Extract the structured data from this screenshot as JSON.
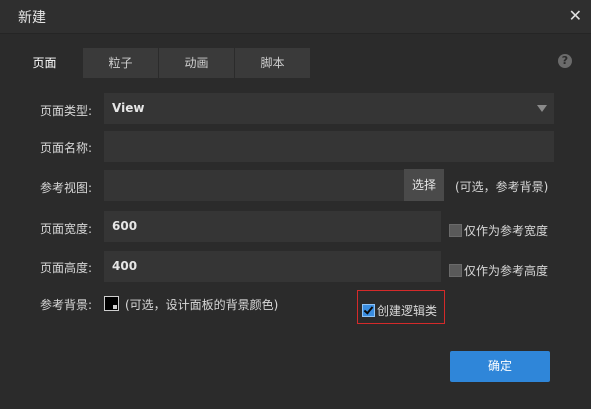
{
  "dialog": {
    "title": "新建"
  },
  "tabs": [
    {
      "label": "页面",
      "active": true
    },
    {
      "label": "粒子",
      "active": false
    },
    {
      "label": "动画",
      "active": false
    },
    {
      "label": "脚本",
      "active": false
    }
  ],
  "help": {
    "glyph": "?"
  },
  "close": {
    "glyph": "✕"
  },
  "form": {
    "page_type": {
      "label": "页面类型:",
      "value": "View"
    },
    "page_name": {
      "label": "页面名称:",
      "value": ""
    },
    "ref_view": {
      "label": "参考视图:",
      "value": "",
      "button": "选择",
      "hint": "(可选，参考背景)"
    },
    "page_width": {
      "label": "页面宽度:",
      "value": "600",
      "checkbox": "仅作为参考宽度",
      "checked": false
    },
    "page_height": {
      "label": "页面高度:",
      "value": "400",
      "checkbox": "仅作为参考高度",
      "checked": false
    },
    "ref_bg": {
      "label": "参考背景:",
      "hint": "(可选，设计面板的背景颜色)",
      "color": "#000000"
    },
    "create_logic": {
      "label": "创建逻辑类",
      "checked": true
    }
  },
  "ok_button": {
    "label": "确定"
  },
  "colors": {
    "accent": "#2f86d9",
    "highlight": "#d42a2a",
    "background": "#2b2b2b"
  }
}
